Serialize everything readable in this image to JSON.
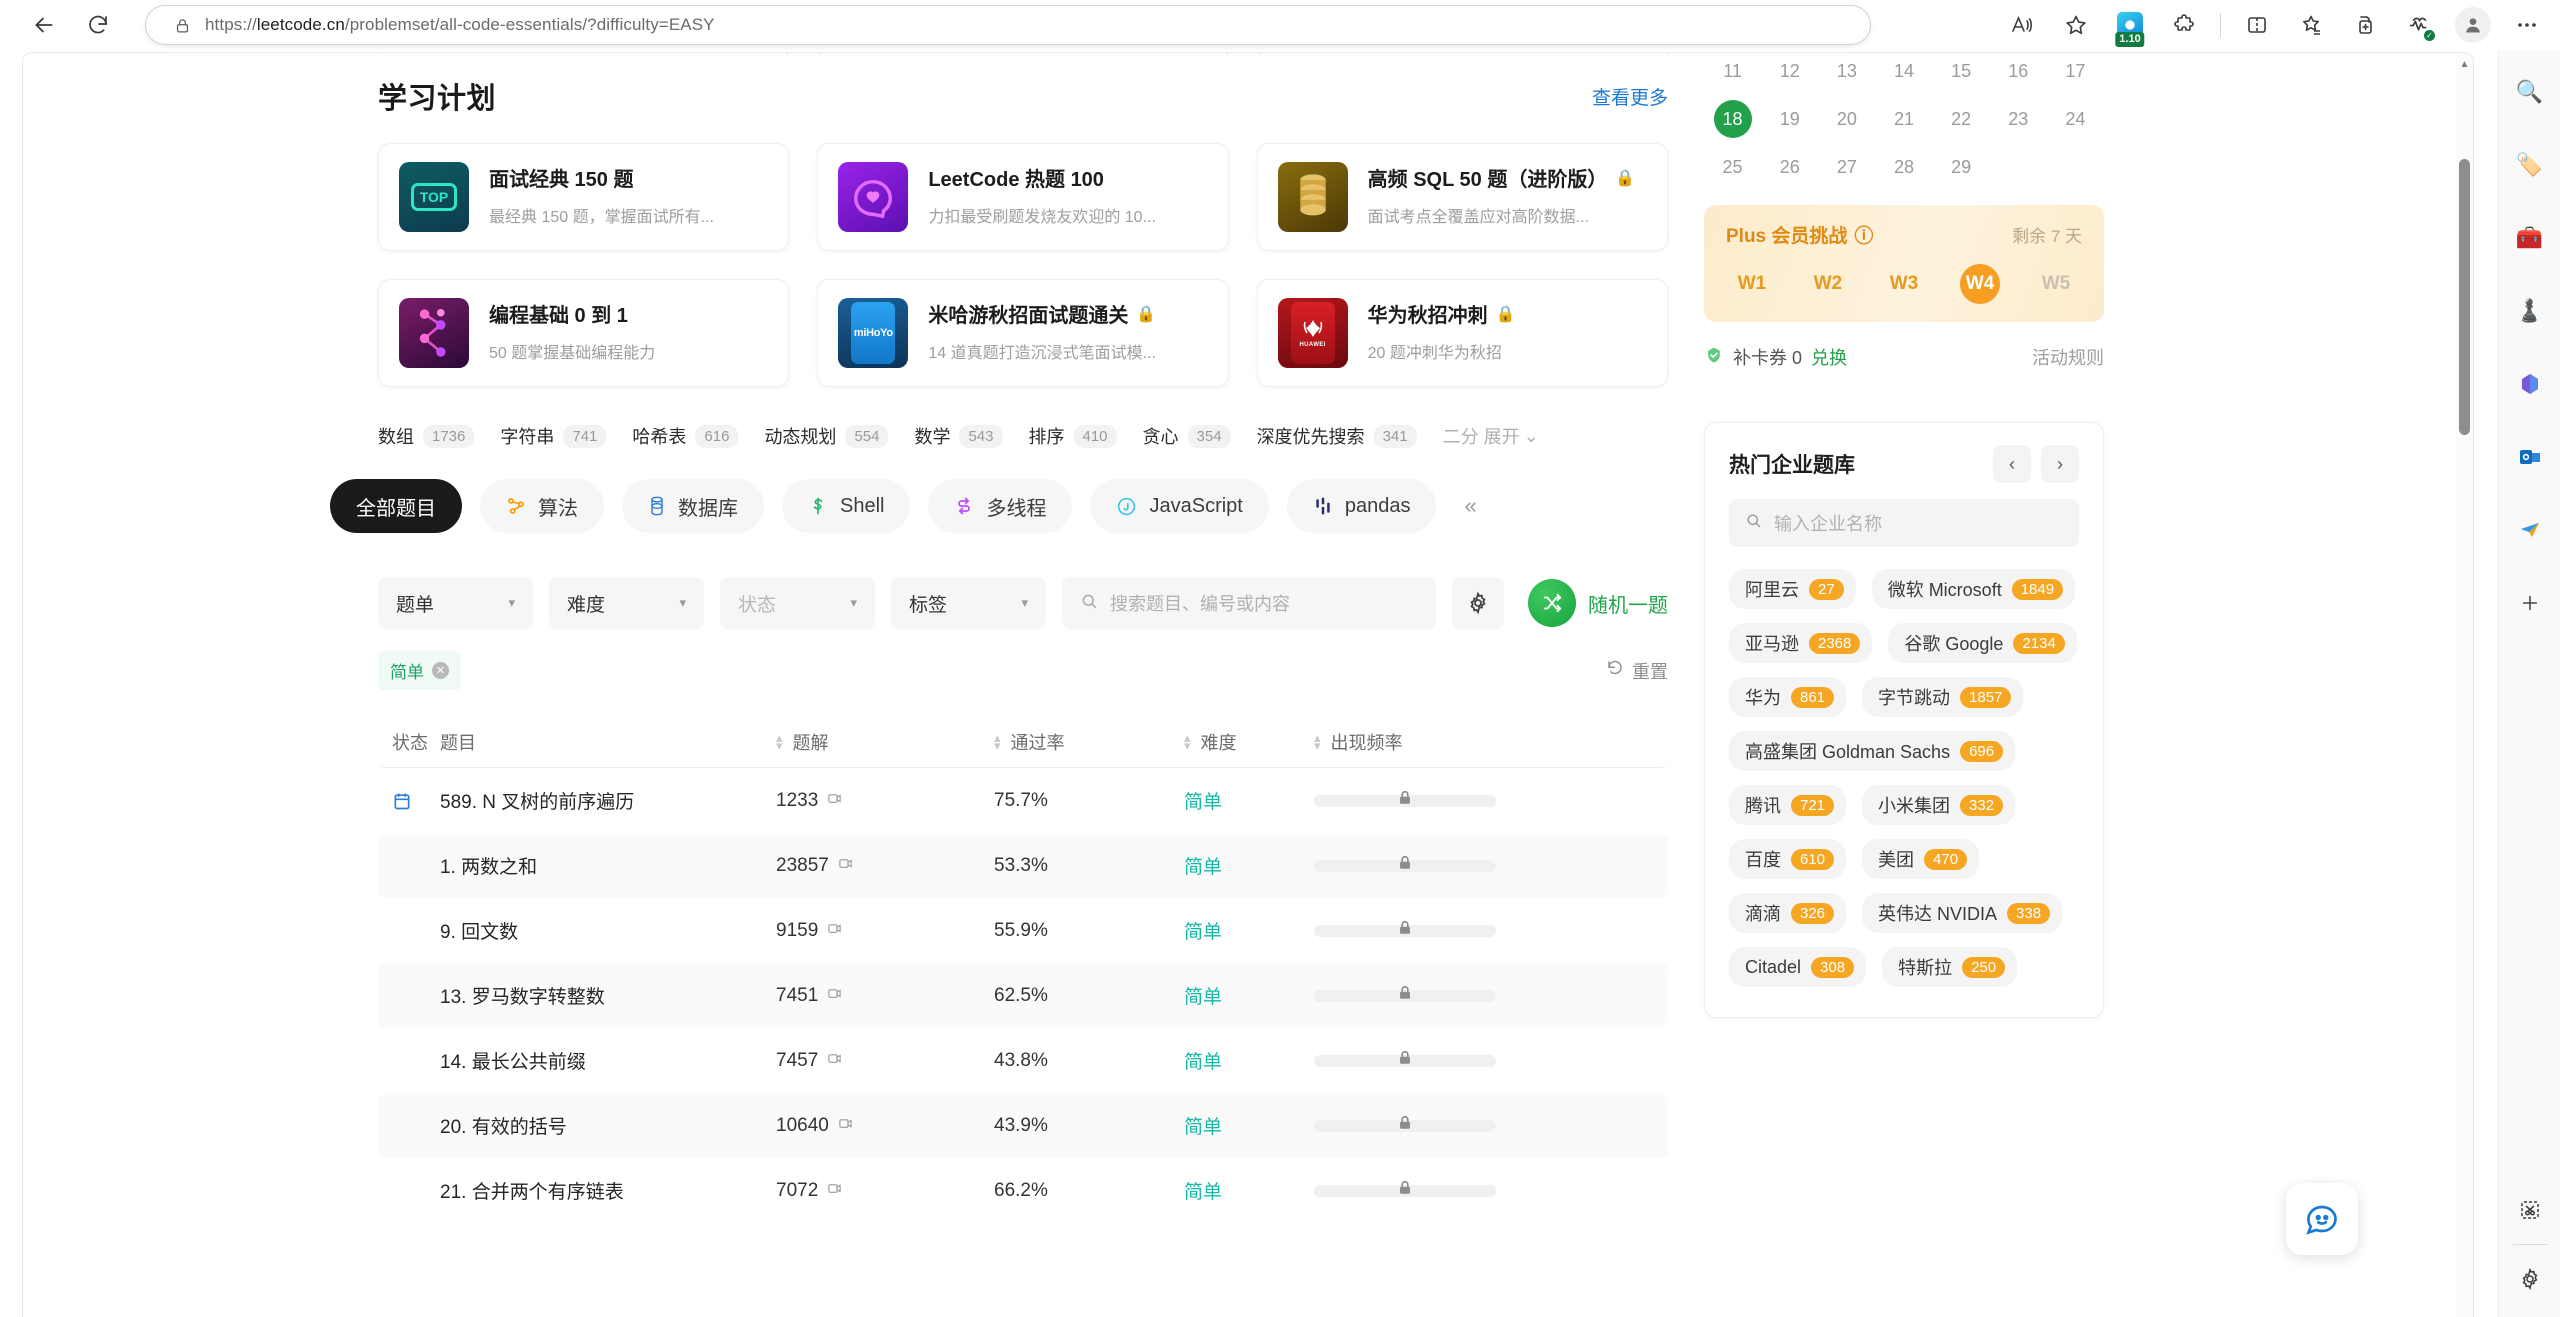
{
  "browser": {
    "url_prefix": "https://",
    "url_host": "leetcode.cn",
    "url_path": "/problemset/all-code-essentials/?difficulty=EASY",
    "back_icon": "back-arrow-icon",
    "reload_icon": "reload-icon",
    "lock_icon": "lock-icon",
    "extension_badge": "1.10",
    "toolbar_icons": [
      "read-aloud-icon",
      "favorite-star-icon",
      "extension-app-icon",
      "extensions-puzzle-icon",
      "split-screen-icon",
      "collections-icon",
      "add-tab-group-icon",
      "browser-essentials-icon",
      "profile-icon",
      "settings-more-icon"
    ],
    "rail_icons": [
      "search-icon",
      "shopping-tag-icon",
      "tools-briefcase-icon",
      "games-chess-icon",
      "microsoft365-icon",
      "outlook-icon",
      "send-plane-icon",
      "add-sidebar-icon",
      "screenshot-scissors-icon",
      "sidebar-settings-gear-icon"
    ]
  },
  "study_plan": {
    "title": "学习计划",
    "more_label": "查看更多",
    "cards": [
      {
        "name": "面试经典 150 题",
        "desc": "最经典 150 题，掌握面试所有...",
        "locked": false,
        "thumb": "top-badge-icon",
        "thumb_class": "th-top"
      },
      {
        "name": "LeetCode 热题 100",
        "desc": "力扣最受刷题发烧友欢迎的 10...",
        "locked": false,
        "thumb": "heart-bubble-icon",
        "thumb_class": "th-hot"
      },
      {
        "name": "高频 SQL 50 题（进阶版）",
        "desc": "面试考点全覆盖应对高阶数据...",
        "locked": true,
        "thumb": "database-stack-icon",
        "thumb_class": "th-sql"
      },
      {
        "name": "编程基础 0 到 1",
        "desc": "50 题掌握基础编程能力",
        "locked": false,
        "thumb": "graph-nodes-icon",
        "thumb_class": "th-prog"
      },
      {
        "name": "米哈游秋招面试题通关",
        "desc": "14 道真题打造沉浸式笔面试模...",
        "locked": true,
        "thumb": "mihoyo-logo-icon",
        "thumb_class": "th-mihoyo"
      },
      {
        "name": "华为秋招冲刺",
        "desc": "20 题冲刺华为秋招",
        "locked": true,
        "thumb": "huawei-logo-icon",
        "thumb_class": "th-huawei"
      }
    ]
  },
  "topic_tags": [
    {
      "label": "数组",
      "count": "1736"
    },
    {
      "label": "字符串",
      "count": "741"
    },
    {
      "label": "哈希表",
      "count": "616"
    },
    {
      "label": "动态规划",
      "count": "554"
    },
    {
      "label": "数学",
      "count": "543"
    },
    {
      "label": "排序",
      "count": "410"
    },
    {
      "label": "贪心",
      "count": "354"
    },
    {
      "label": "深度优先搜索",
      "count": "341"
    }
  ],
  "topic_expand": "二分 展开",
  "category_tabs": [
    {
      "label": "全部题目",
      "icon": "grid-icon",
      "active": true
    },
    {
      "label": "算法",
      "icon": "algorithm-icon",
      "active": false
    },
    {
      "label": "数据库",
      "icon": "database-icon",
      "active": false
    },
    {
      "label": "Shell",
      "icon": "shell-icon",
      "active": false
    },
    {
      "label": "多线程",
      "icon": "threads-icon",
      "active": false
    },
    {
      "label": "JavaScript",
      "icon": "javascript-icon",
      "active": false
    },
    {
      "label": "pandas",
      "icon": "pandas-icon",
      "active": false
    }
  ],
  "filters": {
    "selects": [
      {
        "label": "题单",
        "muted": false
      },
      {
        "label": "难度",
        "muted": false
      },
      {
        "label": "状态",
        "muted": true
      },
      {
        "label": "标签",
        "muted": false
      }
    ],
    "search_placeholder": "搜索题目、编号或内容",
    "gear_icon": "settings-gear-icon",
    "random_label": "随机一题",
    "random_icon": "shuffle-icon",
    "active_chip": "简单",
    "reset_label": "重置",
    "reset_icon": "reset-arrow-icon"
  },
  "table": {
    "headers": [
      "状态",
      "题目",
      "题解",
      "通过率",
      "难度",
      "出现频率"
    ],
    "rows": [
      {
        "status": "calendar-icon",
        "title": "589. N 叉树的前序遍历",
        "solutions": "1233",
        "rate": "75.7%",
        "difficulty": "简单"
      },
      {
        "status": "",
        "title": "1. 两数之和",
        "solutions": "23857",
        "rate": "53.3%",
        "difficulty": "简单"
      },
      {
        "status": "",
        "title": "9. 回文数",
        "solutions": "9159",
        "rate": "55.9%",
        "difficulty": "简单"
      },
      {
        "status": "",
        "title": "13. 罗马数字转整数",
        "solutions": "7451",
        "rate": "62.5%",
        "difficulty": "简单"
      },
      {
        "status": "",
        "title": "14. 最长公共前缀",
        "solutions": "7457",
        "rate": "43.8%",
        "difficulty": "简单"
      },
      {
        "status": "",
        "title": "20. 有效的括号",
        "solutions": "10640",
        "rate": "43.9%",
        "difficulty": "简单"
      },
      {
        "status": "",
        "title": "21. 合并两个有序链表",
        "solutions": "7072",
        "rate": "66.2%",
        "difficulty": "简单"
      }
    ]
  },
  "sidebar": {
    "calendar_days": [
      "11",
      "12",
      "13",
      "14",
      "15",
      "16",
      "17",
      "18",
      "19",
      "20",
      "21",
      "22",
      "23",
      "24",
      "25",
      "26",
      "27",
      "28",
      "29"
    ],
    "today": "18",
    "plus": {
      "title": "Plus 会员挑战",
      "help_icon": "question-circle-icon",
      "remaining": "剩余 7 天",
      "weeks": [
        "W1",
        "W2",
        "W3",
        "W4",
        "W5"
      ],
      "current_week": "W4"
    },
    "card_coupon": {
      "icon": "shield-check-icon",
      "label": "补卡券 0",
      "redeem": "兑换",
      "rules": "活动规则"
    },
    "company": {
      "title": "热门企业题库",
      "prev_icon": "chevron-left-icon",
      "next_icon": "chevron-right-icon",
      "search_placeholder": "输入企业名称",
      "search_icon": "search-icon",
      "tags": [
        {
          "name": "阿里云",
          "count": "27"
        },
        {
          "name": "微软 Microsoft",
          "count": "1849"
        },
        {
          "name": "亚马逊",
          "count": "2368"
        },
        {
          "name": "谷歌 Google",
          "count": "2134"
        },
        {
          "name": "华为",
          "count": "861"
        },
        {
          "name": "字节跳动",
          "count": "1857"
        },
        {
          "name": "高盛集团 Goldman Sachs",
          "count": "696"
        },
        {
          "name": "腾讯",
          "count": "721"
        },
        {
          "name": "小米集团",
          "count": "332"
        },
        {
          "name": "百度",
          "count": "610"
        },
        {
          "name": "美团",
          "count": "470"
        },
        {
          "name": "滴滴",
          "count": "326"
        },
        {
          "name": "英伟达 NVIDIA",
          "count": "338"
        },
        {
          "name": "Citadel",
          "count": "308"
        },
        {
          "name": "特斯拉",
          "count": "250"
        }
      ]
    }
  },
  "floating": {
    "feedback_icon": "feedback-smile-icon"
  },
  "colors": {
    "accent_green": "#22a04a",
    "easy": "#15b8a6",
    "orange": "#f5a623",
    "link": "#1a7bd4"
  }
}
